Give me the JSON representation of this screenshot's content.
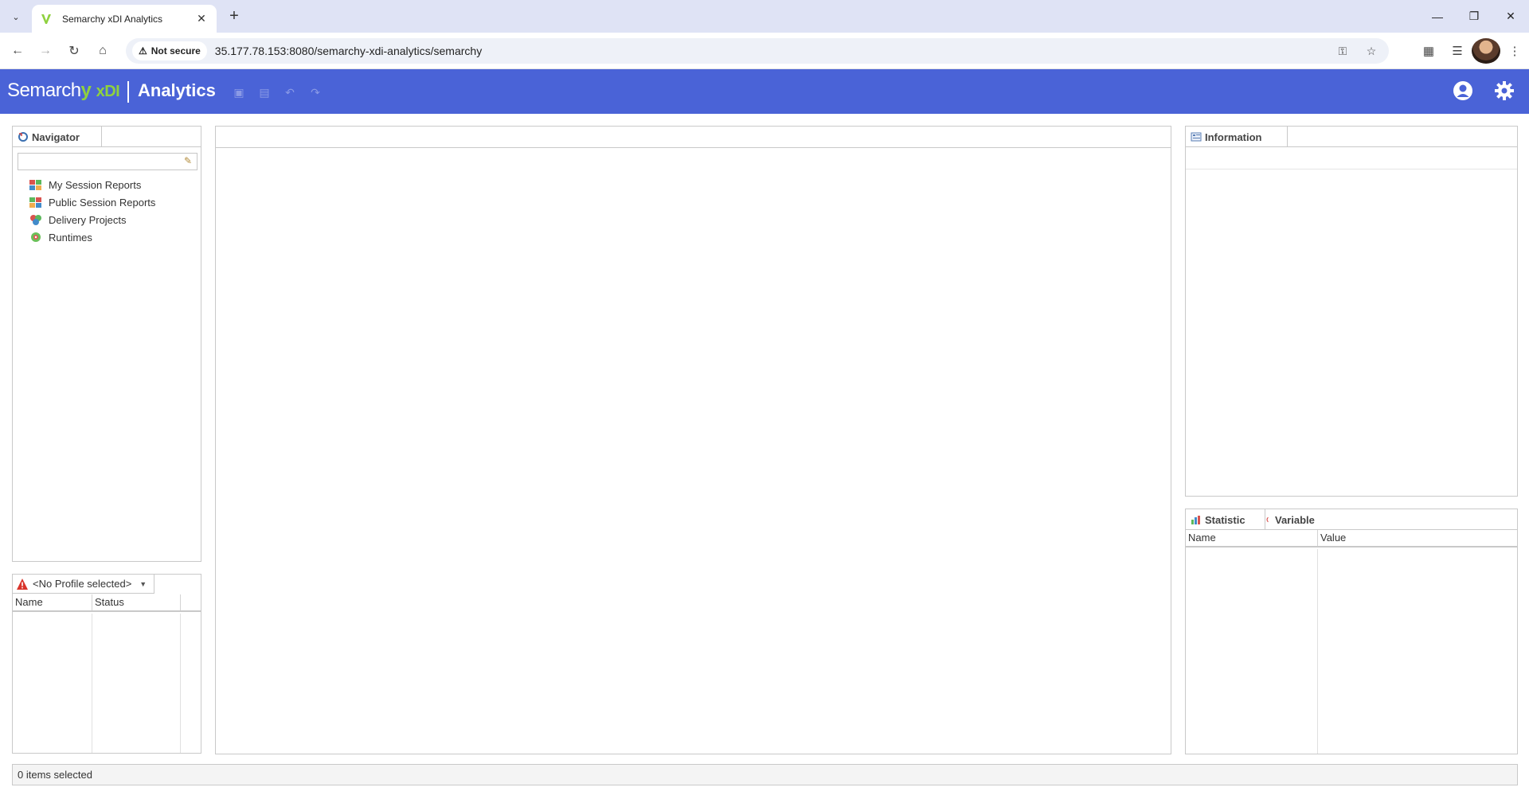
{
  "browser": {
    "tab_title": "Semarchy xDI Analytics",
    "security_label": "Not secure",
    "url": "35.177.78.153:8080/semarchy-xdi-analytics/semarchy"
  },
  "app": {
    "logo_text": "Semarch",
    "logo_y": "y",
    "logo_xdi": "xDI",
    "title": "Analytics",
    "brand_color": "#4a63d7"
  },
  "navigator": {
    "tab_label": "Navigator",
    "search_value": "",
    "items": [
      {
        "label": "My Session Reports",
        "icon": "session-reports-icon"
      },
      {
        "label": "Public Session Reports",
        "icon": "public-reports-icon"
      },
      {
        "label": "Delivery Projects",
        "icon": "delivery-projects-icon"
      },
      {
        "label": "Runtimes",
        "icon": "runtimes-icon"
      }
    ]
  },
  "profile": {
    "selected": "<No Profile selected>",
    "columns": [
      "Name",
      "Status"
    ]
  },
  "information": {
    "tab_label": "Information"
  },
  "statistic": {
    "tabs": [
      "Statistic",
      "Variable"
    ],
    "columns": [
      "Name",
      "Value"
    ]
  },
  "status": {
    "text": "0 items selected"
  }
}
